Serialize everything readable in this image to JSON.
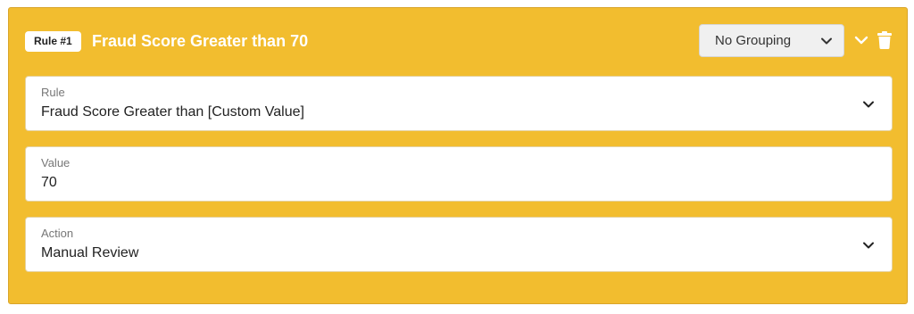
{
  "rule": {
    "badge": "Rule #1",
    "title": "Fraud Score Greater than 70"
  },
  "grouping": {
    "selected": "No Grouping"
  },
  "icons": {
    "grouping_dropdown": "chevron-down-icon",
    "collapse": "chevron-down-icon",
    "delete": "trash-icon"
  },
  "fields": {
    "rule": {
      "label": "Rule",
      "value": "Fraud Score Greater than [Custom Value]"
    },
    "value": {
      "label": "Value",
      "value": "70"
    },
    "action": {
      "label": "Action",
      "value": "Manual Review"
    }
  },
  "colors": {
    "card_background": "#f2bd2f",
    "title_text": "#ffffff",
    "field_background": "#ffffff"
  }
}
